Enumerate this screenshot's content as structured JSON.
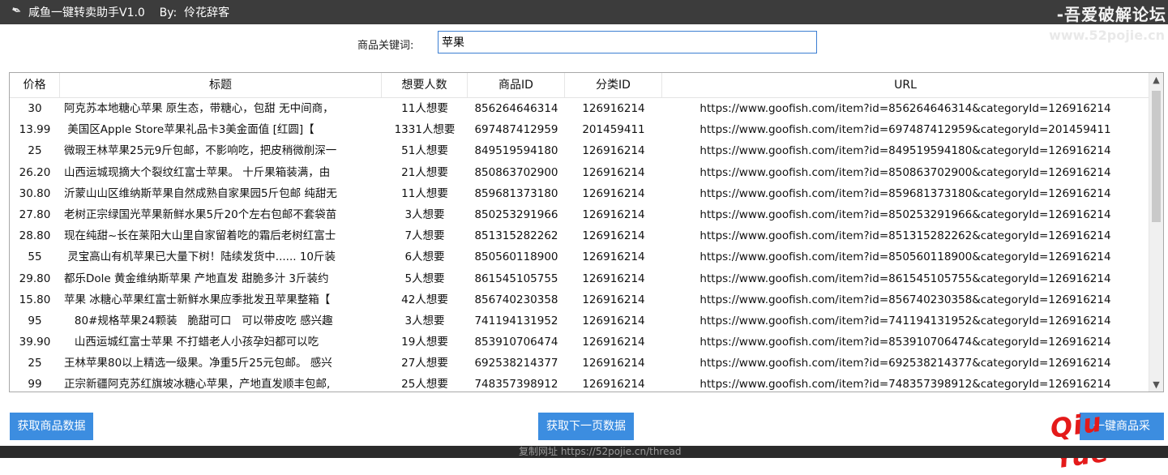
{
  "window": {
    "app_title": "咸鱼一键转卖助手V1.0",
    "author": "By:  伶花辞客",
    "icon": "feather-icon"
  },
  "watermark": {
    "top": "-吾爱破解论坛",
    "sub": "www.52pojie.cn"
  },
  "search": {
    "label": "商品关键词:",
    "value": "苹果"
  },
  "table": {
    "columns": [
      "价格",
      "标题",
      "想要人数",
      "商品ID",
      "分类ID",
      "URL"
    ],
    "rows": [
      {
        "price": "30",
        "title": "阿克苏本地糖心苹果 原生态，带糖心，包甜 无中间商，",
        "want": "11人想要",
        "pid": "856264646314",
        "cid": "126916214",
        "url": "https://www.goofish.com/item?id=856264646314&categoryId=126916214"
      },
      {
        "price": "13.99",
        "title": " 美国区Apple Store苹果礼品卡3美金面值 [红圆]【",
        "want": "1331人想要",
        "pid": "697487412959",
        "cid": "201459411",
        "url": "https://www.goofish.com/item?id=697487412959&categoryId=201459411"
      },
      {
        "price": "25",
        "title": "微瑕王林苹果25元9斤包邮，不影响吃，把皮稍微削深一",
        "want": "51人想要",
        "pid": "849519594180",
        "cid": "126916214",
        "url": "https://www.goofish.com/item?id=849519594180&categoryId=126916214"
      },
      {
        "price": "26.20",
        "title": "山西运城现摘大个裂纹红富士苹果。 十斤果箱装满，由",
        "want": "21人想要",
        "pid": "850863702900",
        "cid": "126916214",
        "url": "https://www.goofish.com/item?id=850863702900&categoryId=126916214"
      },
      {
        "price": "30.80",
        "title": "沂蒙山山区维纳斯苹果自然成熟自家果园5斤包邮 纯甜无",
        "want": "11人想要",
        "pid": "859681373180",
        "cid": "126916214",
        "url": "https://www.goofish.com/item?id=859681373180&categoryId=126916214"
      },
      {
        "price": "27.80",
        "title": "老树正宗绿国光苹果新鲜水果5斤20个左右包邮不套袋苗",
        "want": "3人想要",
        "pid": "850253291966",
        "cid": "126916214",
        "url": "https://www.goofish.com/item?id=850253291966&categoryId=126916214"
      },
      {
        "price": "28.80",
        "title": "现在纯甜~长在莱阳大山里自家留着吃的霜后老树红富士",
        "want": "7人想要",
        "pid": "851315282262",
        "cid": "126916214",
        "url": "https://www.goofish.com/item?id=851315282262&categoryId=126916214"
      },
      {
        "price": "55",
        "title": " 灵宝高山有机苹果已大量下树！陆续发货中...... 10斤装",
        "want": "6人想要",
        "pid": "850560118900",
        "cid": "126916214",
        "url": "https://www.goofish.com/item?id=850560118900&categoryId=126916214"
      },
      {
        "price": "29.80",
        "title": "都乐Dole 黄金维纳斯苹果 产地直发 甜脆多汁 3斤装约",
        "want": "5人想要",
        "pid": "861545105755",
        "cid": "126916214",
        "url": "https://www.goofish.com/item?id=861545105755&categoryId=126916214"
      },
      {
        "price": "15.80",
        "title": "苹果 冰糖心苹果红富士新鲜水果应季批发丑苹果整箱【",
        "want": "42人想要",
        "pid": "856740230358",
        "cid": "126916214",
        "url": "https://www.goofish.com/item?id=856740230358&categoryId=126916214"
      },
      {
        "price": "95",
        "title": "   80#规格苹果24颗装   脆甜可口   可以带皮吃 感兴趣",
        "want": "3人想要",
        "pid": "741194131952",
        "cid": "126916214",
        "url": "https://www.goofish.com/item?id=741194131952&categoryId=126916214"
      },
      {
        "price": "39.90",
        "title": "   山西运城红富士苹果 不打蜡老人小孩孕妇都可以吃",
        "want": "19人想要",
        "pid": "853910706474",
        "cid": "126916214",
        "url": "https://www.goofish.com/item?id=853910706474&categoryId=126916214"
      },
      {
        "price": "25",
        "title": "王林苹果80以上精选一级果。净重5斤25元包邮。 感兴",
        "want": "27人想要",
        "pid": "692538214377",
        "cid": "126916214",
        "url": "https://www.goofish.com/item?id=692538214377&categoryId=126916214"
      },
      {
        "price": "99",
        "title": "正宗新疆阿克苏红旗坡冰糖心苹果，产地直发顺丰包邮,",
        "want": "25人想要",
        "pid": "748357398912",
        "cid": "126916214",
        "url": "https://www.goofish.com/item?id=748357398912&categoryId=126916214"
      }
    ]
  },
  "buttons": {
    "fetch": "获取商品数据",
    "next_page": "获取下一页数据",
    "third": "一键商品采"
  },
  "overlay": {
    "signature": "Qiu Yue"
  },
  "taskbar": {
    "text": "复制网址 https://52pojie.cn/thread"
  }
}
